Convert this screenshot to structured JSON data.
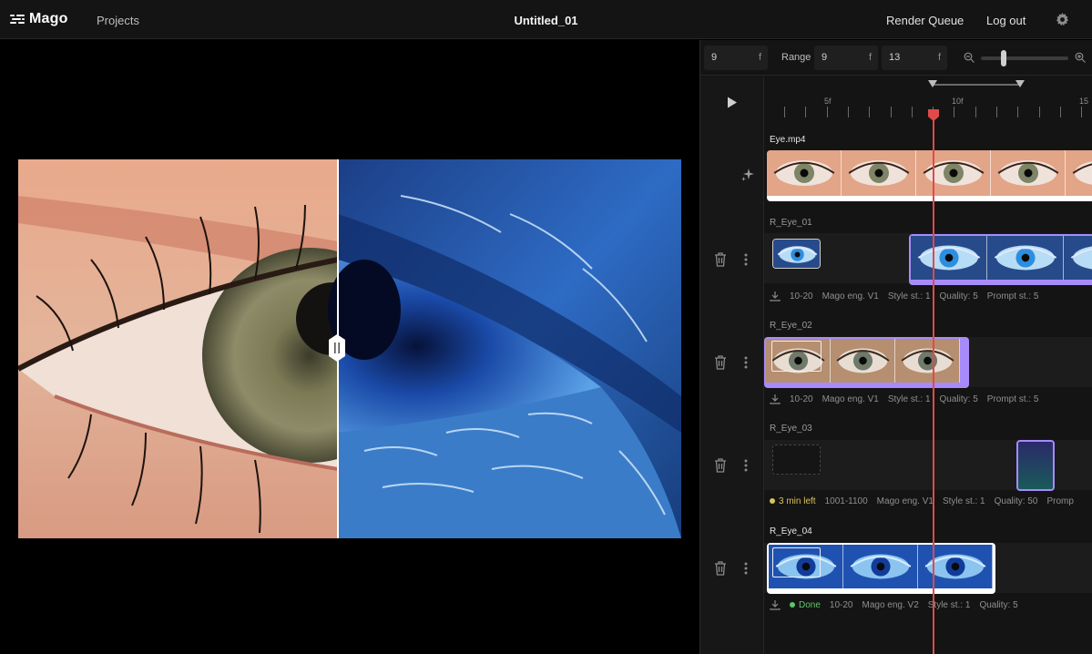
{
  "app": {
    "logo": "Mago",
    "document_title": "Untitled_01"
  },
  "nav": {
    "projects": "Projects",
    "render_queue": "Render Queue",
    "log_out": "Log out"
  },
  "controls": {
    "frame_value": "9",
    "frame_unit": "f",
    "range_label": "Range",
    "range_start": "9",
    "range_start_unit": "f",
    "range_end": "13",
    "range_end_unit": "f",
    "zoom_level": 0.25
  },
  "ruler": {
    "labels": [
      "5f",
      "10f",
      "15"
    ]
  },
  "tracks": [
    {
      "label": "Eye.mp4",
      "type": "source"
    },
    {
      "label": "R_Eye_01",
      "meta": [
        "10-20",
        "Mago eng. V1",
        "Style st.: 1",
        "Quality: 5",
        "Prompt st.: 5"
      ]
    },
    {
      "label": "R_Eye_02",
      "meta": [
        "10-20",
        "Mago eng. V1",
        "Style st.: 1",
        "Quality: 5",
        "Prompt st.: 5"
      ]
    },
    {
      "label": "R_Eye_03",
      "status": "3 min left",
      "meta": [
        "1001-1100",
        "Mago eng. V1",
        "Style st.: 1",
        "Quality: 50",
        "Promp"
      ]
    },
    {
      "label": "R_Eye_04",
      "status": "Done",
      "meta": [
        "10-20",
        "Mago eng. V2",
        "Style st.: 1",
        "Quality: 5"
      ]
    }
  ],
  "colors": {
    "accent": "#a78bfa",
    "playhead": "#e04a4a",
    "done": "#5fc46a",
    "progress": "#d9c25a"
  }
}
